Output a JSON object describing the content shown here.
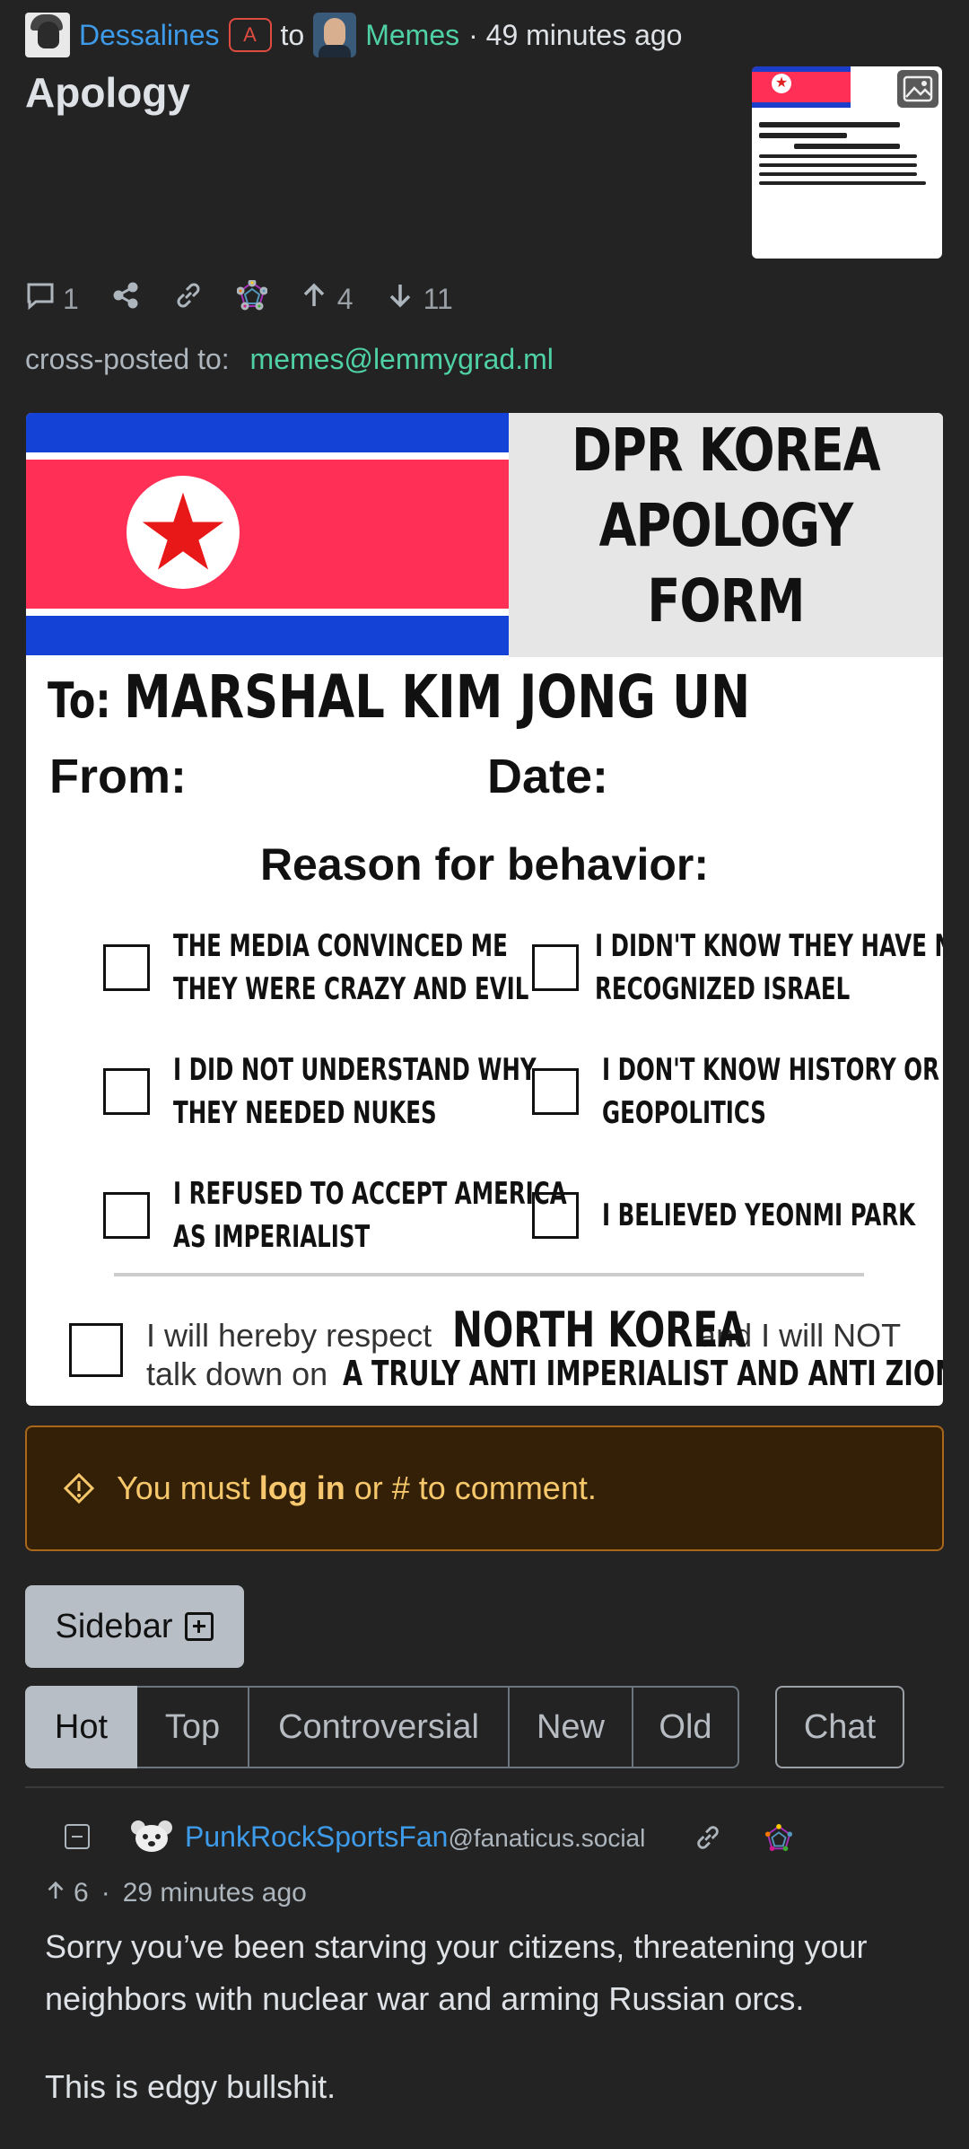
{
  "post": {
    "author": "Dessalines",
    "author_badge": "A",
    "to_word": "to",
    "community": "Memes",
    "time": "· 49 minutes ago",
    "title": "Apology",
    "comments_count": "1",
    "upvotes": "4",
    "downvotes": "11",
    "crossposted_label": "cross-posted to:",
    "crossposted_to": "memes@lemmygrad.ml"
  },
  "image": {
    "heading_lines": [
      "DPR KOREA",
      "APOLOGY",
      "FORM"
    ],
    "to_label": "To:",
    "to_name": "MARSHAL KIM JONG UN",
    "from_label": "From:",
    "date_label": "Date:",
    "reason_heading": "Reason for behavior:",
    "options": [
      [
        "THE MEDIA CONVINCED ME",
        "THEY WERE CRAZY AND EVIL"
      ],
      [
        "I DIDN'T KNOW THEY HAVE NEVER",
        "RECOGNIZED ISRAEL"
      ],
      [
        "I DID NOT UNDERSTAND WHY",
        "THEY NEEDED NUKES"
      ],
      [
        "I DON'T KNOW HISTORY OR",
        "GEOPOLITICS"
      ],
      [
        "I REFUSED TO ACCEPT AMERICA",
        "AS IMPERIALIST"
      ],
      [
        "I BELIEVED YEONMI PARK",
        ""
      ]
    ],
    "final_1a": "I will hereby respect",
    "final_1b": "NORTH KOREA",
    "final_1c": "and I will NOT",
    "final_2a": "talk down on",
    "final_2b": "A TRULY ANTI IMPERIALIST AND ANTI ZIONIST NATION"
  },
  "alert": {
    "prefix": "You must",
    "login": "log in",
    "suffix": "or # to comment."
  },
  "sidebar_label": "Sidebar",
  "tabs": [
    "Hot",
    "Top",
    "Controversial",
    "New",
    "Old"
  ],
  "active_tab": "Hot",
  "chat_label": "Chat",
  "comment": {
    "user": "PunkRockSportsFan",
    "instance": "@fanaticus.social",
    "score": "6",
    "time": "29 minutes ago",
    "dot": "·",
    "paragraphs": [
      "Sorry you’ve been starving your citizens, threatening your neighbors with nuclear war and arming Russian orcs.",
      "This is edgy bullshit."
    ]
  },
  "colors": {
    "background": "#232323",
    "link_blue": "#3d9be9",
    "link_teal": "#4fd1a5",
    "alert_text": "#f6c76b",
    "alert_border": "#a8671a"
  },
  "icons": [
    "comment-icon",
    "share-icon",
    "link-icon",
    "fediverse-icon",
    "upvote-icon",
    "downvote-icon",
    "image-icon",
    "warning-icon",
    "plus-square-icon",
    "minus-square-icon"
  ]
}
